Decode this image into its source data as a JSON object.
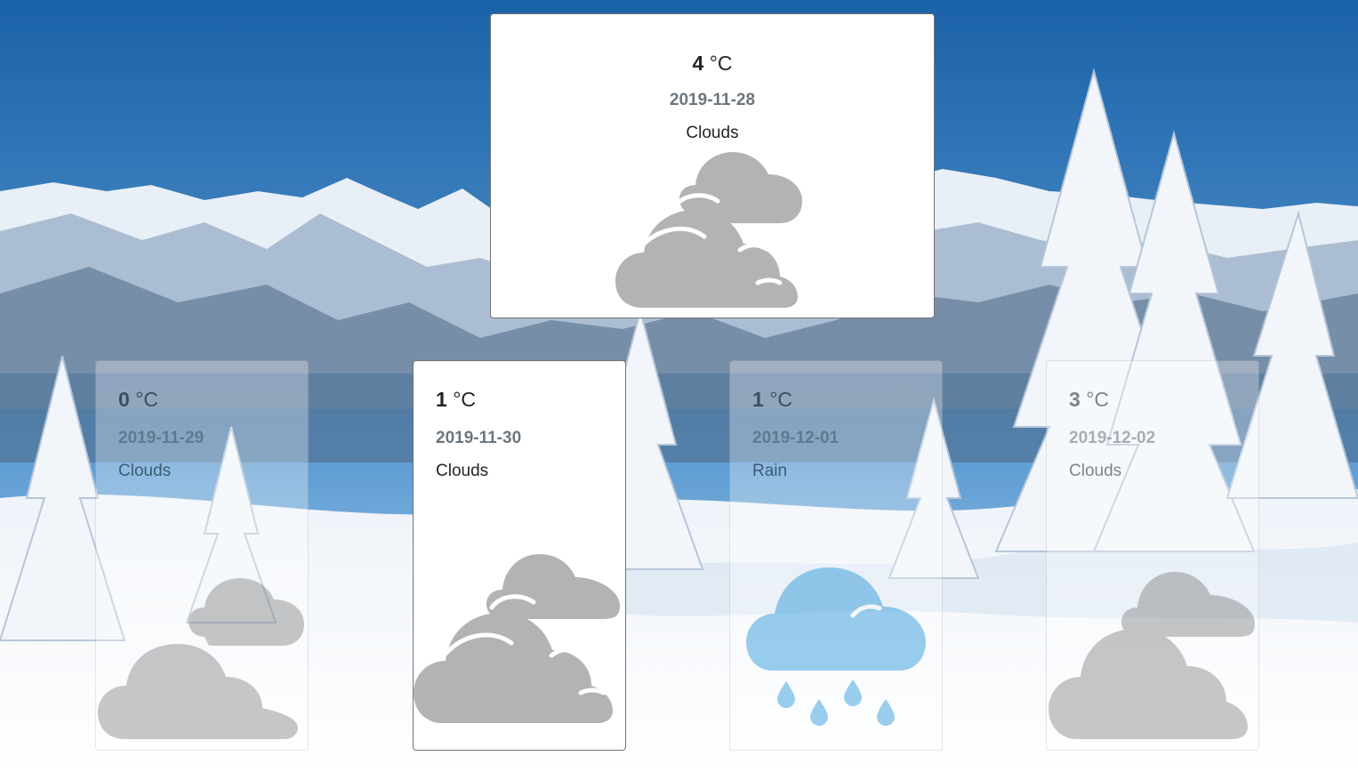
{
  "current": {
    "temp": "4",
    "unit": "°C",
    "date": "2019-11-28",
    "description": "Clouds",
    "icon": "clouds-icon"
  },
  "forecast": [
    {
      "temp": "0",
      "unit": "°C",
      "date": "2019-11-29",
      "description": "Clouds",
      "icon": "clouds-icon"
    },
    {
      "temp": "1",
      "unit": "°C",
      "date": "2019-11-30",
      "description": "Clouds",
      "icon": "clouds-icon"
    },
    {
      "temp": "1",
      "unit": "°C",
      "date": "2019-12-01",
      "description": "Rain",
      "icon": "rain-icon"
    },
    {
      "temp": "3",
      "unit": "°C",
      "date": "2019-12-02",
      "description": "Clouds",
      "icon": "clouds-icon"
    }
  ],
  "colors": {
    "cloud": "#b3b3b3",
    "rain_cloud": "#8cc6ea",
    "rain_drop": "#8cc6ea"
  }
}
